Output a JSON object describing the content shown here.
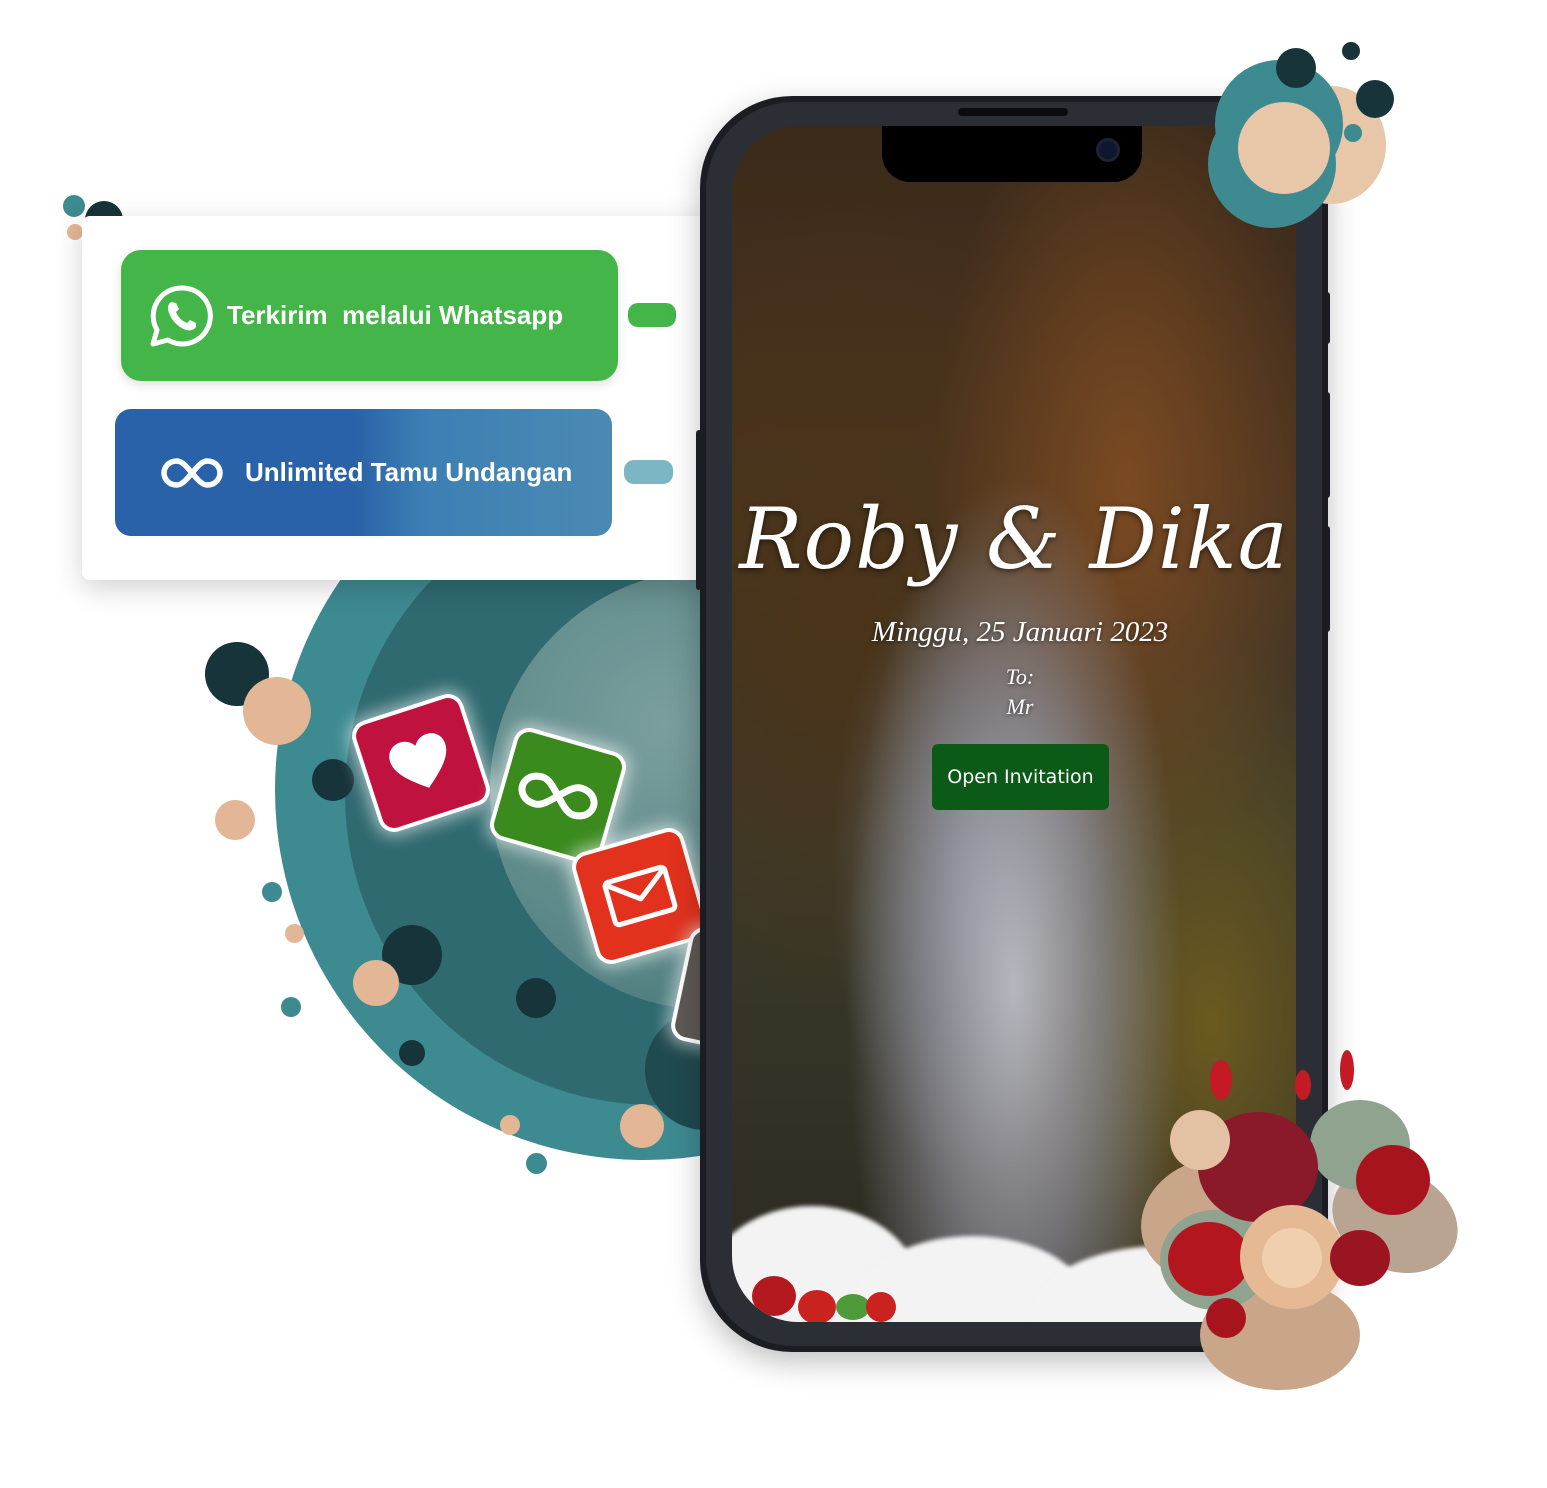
{
  "features": {
    "whatsapp_label": "Terkirim  melalui Whatsapp",
    "unlimited_label": "Unlimited Tamu Undangan"
  },
  "invitation": {
    "couple_names": "Roby & Dika",
    "date": "Minggu, 25 Januari 2023",
    "to_label": "To:",
    "guest_name": "Mr",
    "open_button": "Open Invitation"
  },
  "icons": {
    "whatsapp": "whatsapp-icon",
    "infinity": "infinity-icon",
    "heart_tile": "heart-icon",
    "infinity_tile": "infinity-icon",
    "mail_tile": "mail-icon",
    "contact_tile": "contact-icon"
  },
  "colors": {
    "whatsapp_green": "#44b548",
    "unlimited_blue": "#2962a8",
    "teal": "#3e8a91",
    "button_green": "#0c5a17",
    "heart_tile": "#c0123f",
    "infinity_tile": "#3a8a1e",
    "mail_tile": "#e2321d",
    "contact_tile": "#5d5a55"
  }
}
